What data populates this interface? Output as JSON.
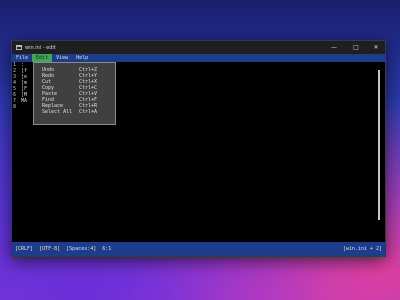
{
  "window": {
    "title": "win.ini - edit"
  },
  "titlebar_buttons": {
    "minimize": "—",
    "maximize": "□",
    "close": "✕"
  },
  "menubar": {
    "items": [
      "File",
      "Edit",
      "View",
      "Help"
    ],
    "active": "Edit"
  },
  "editor": {
    "lines": [
      {
        "num": "1",
        "text": "; "
      },
      {
        "num": "2",
        "text": "[f"
      },
      {
        "num": "3",
        "text": "[e"
      },
      {
        "num": "4",
        "text": "[m"
      },
      {
        "num": "5",
        "text": "[F"
      },
      {
        "num": "6",
        "text": "[M"
      },
      {
        "num": "7",
        "text": "MA"
      },
      {
        "num": "8",
        "text": ""
      }
    ]
  },
  "edit_menu": {
    "items": [
      {
        "label": "Undo",
        "shortcut": "Ctrl+Z"
      },
      {
        "label": "Redo",
        "shortcut": "Ctrl+Y"
      },
      {
        "label": "Cut",
        "shortcut": "Ctrl+X"
      },
      {
        "label": "Copy",
        "shortcut": "Ctrl+C"
      },
      {
        "label": "Paste",
        "shortcut": "Ctrl+V"
      },
      {
        "label": "Find",
        "shortcut": "Ctrl+F"
      },
      {
        "label": "Replace",
        "shortcut": "Ctrl+R"
      },
      {
        "label": "Select All",
        "shortcut": "Ctrl+A"
      }
    ]
  },
  "statusbar": {
    "line_ending": "[CRLF]",
    "encoding": "[UTF-8]",
    "indent": "[Spaces:4]",
    "position": "6:1",
    "file": "[win.ini + 2]"
  }
}
